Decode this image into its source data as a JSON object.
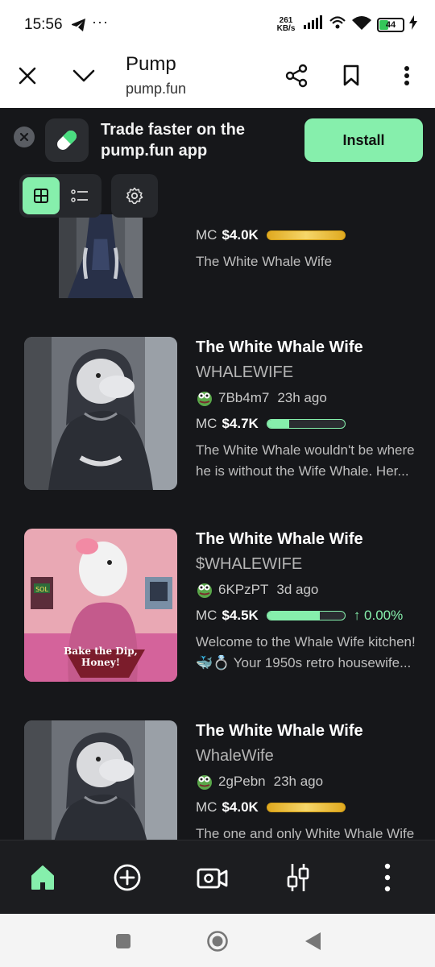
{
  "status_bar": {
    "time": "15:56",
    "more": "···",
    "net_speed_value": "261",
    "net_speed_unit": "KB/s",
    "battery": "44",
    "battery_level": 0.44
  },
  "browser": {
    "page_title": "Pump",
    "page_url": "pump.fun"
  },
  "banner": {
    "text": "Trade faster on the pump.fun app",
    "install_label": "Install"
  },
  "colors": {
    "accent": "#86efac",
    "background": "#16171a",
    "gold_bar": "#e0a91f"
  },
  "coins": [
    {
      "name": "",
      "ticker": "",
      "mc_label": "MC",
      "mc_value": "$4.0K",
      "progress": 1.0,
      "bar_style": "gold",
      "description": "The White Whale Wife"
    },
    {
      "name": "The White Whale Wife",
      "ticker": "WHALEWIFE",
      "creator": "7Bb4m7",
      "time": "23h ago",
      "mc_label": "MC",
      "mc_value": "$4.7K",
      "progress": 0.28,
      "bar_style": "green",
      "description": "The White Whale wouldn't be where\nhe is without the Wife Whale. Her..."
    },
    {
      "name": "The White Whale Wife",
      "ticker": "$WHALEWIFE",
      "creator": "6KPzPT",
      "time": "3d ago",
      "mc_label": "MC",
      "mc_value": "$4.5K",
      "progress": 0.68,
      "bar_style": "green",
      "change": "↑ 0.00%",
      "description": "Welcome to the Whale Wife kitchen!\n🐳💍 Your 1950s retro housewife...",
      "image_text_1": "Bake the Dip,",
      "image_text_2": "Honey!",
      "image_badge": "SOL"
    },
    {
      "name": "The White Whale Wife",
      "ticker": "WhaleWife",
      "creator": "2gPebn",
      "time": "23h ago",
      "mc_label": "MC",
      "mc_value": "$4.0K",
      "progress": 1.0,
      "bar_style": "gold",
      "description": "The one and only White Whale Wife"
    }
  ],
  "icons": {
    "close": "close-icon",
    "chevron": "chevron-down-icon",
    "share": "share-icon",
    "bookmark": "bookmark-icon",
    "menu": "more-vertical-icon",
    "home": "home-icon",
    "create": "plus-circle-icon",
    "live": "video-icon",
    "trade": "candlestick-icon"
  }
}
